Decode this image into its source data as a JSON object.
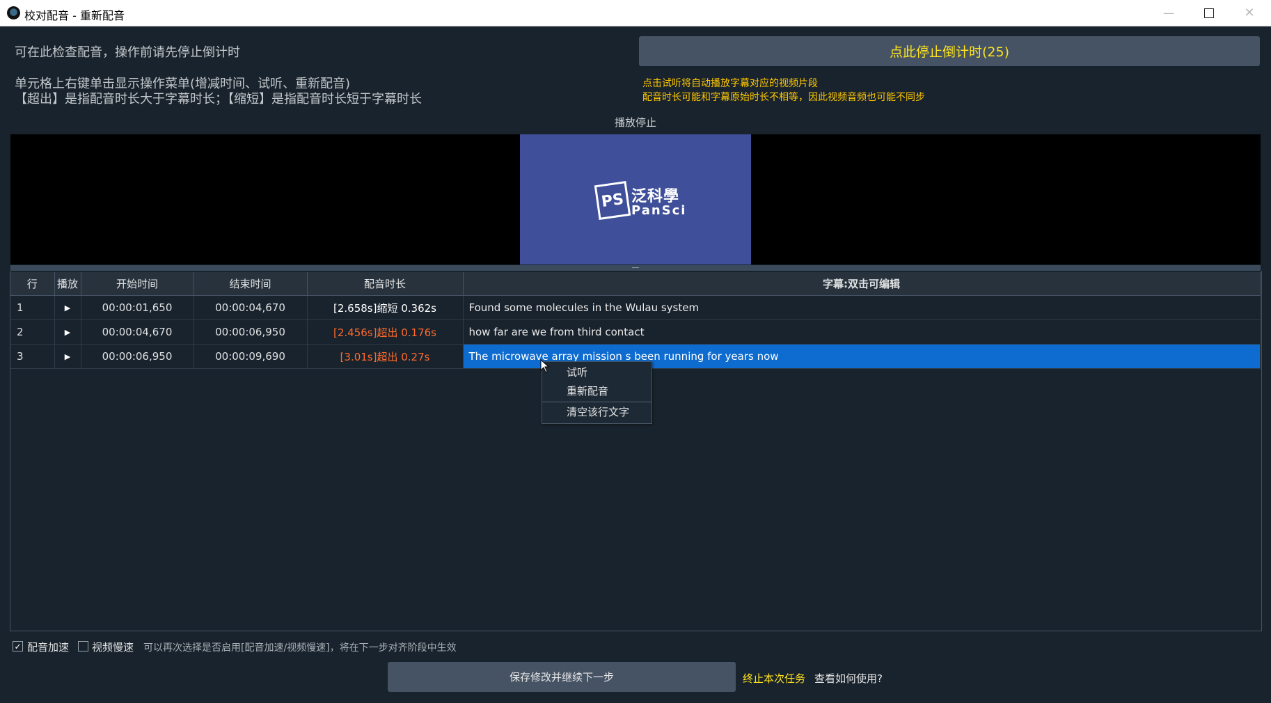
{
  "window": {
    "title": "校对配音 - 重新配音",
    "minimize_glyph": "—",
    "close_glyph": "✕"
  },
  "info": {
    "line1": "可在此检查配音，操作前请先停止倒计时",
    "line2": "单元格上右键单击显示操作菜单(增减时间、试听、重新配音)",
    "line3": "【超出】是指配音时长大于字幕时长；【缩短】是指配音时长短于字幕时长"
  },
  "stop_button": {
    "label": "点此停止倒计时(25)"
  },
  "warnings": {
    "line1": "点击试听将自动播放字幕对应的视频片段",
    "line2": "配音时长可能和字幕原始时长不相等，因此视频音频也可能不同步"
  },
  "player": {
    "status": "播放停止",
    "logo_mark": "PS",
    "logo_cn": "泛科學",
    "logo_en": "PanSci"
  },
  "table": {
    "headers": [
      "行",
      "播放",
      "开始时间",
      "结束时间",
      "配音时长",
      "字幕:双击可编辑"
    ],
    "play_glyph": "▶",
    "rows": [
      {
        "row": "1",
        "start": "00:00:01,650",
        "end": "00:00:04,670",
        "duration": "[2.658s]缩短 0.362s",
        "duration_color": "#ffffff",
        "subtitle": "Found some molecules in the Wulau system"
      },
      {
        "row": "2",
        "start": "00:00:04,670",
        "end": "00:00:06,950",
        "duration": "[2.456s]超出 0.176s",
        "duration_color": "#ff6a2a",
        "subtitle": "how far are we from third contact"
      },
      {
        "row": "3",
        "start": "00:00:06,950",
        "end": "00:00:09,690",
        "duration": "[3.01s]超出 0.27s",
        "duration_color": "#ff6a2a",
        "subtitle": "The microwave array mission s been running for years now"
      }
    ]
  },
  "context_menu": {
    "items": [
      "试听",
      "重新配音",
      "清空该行文字"
    ]
  },
  "options": {
    "voice_speedup": {
      "label": "配音加速",
      "checked": true
    },
    "video_slowdown": {
      "label": "视频慢速",
      "checked": false
    },
    "note": "可以再次选择是否启用[配音加速/视频慢速]，将在下一步对齐阶段中生效"
  },
  "footer": {
    "save_label": "保存修改并继续下一步",
    "abort_label": "终止本次任务",
    "help_label": "查看如何使用?"
  }
}
